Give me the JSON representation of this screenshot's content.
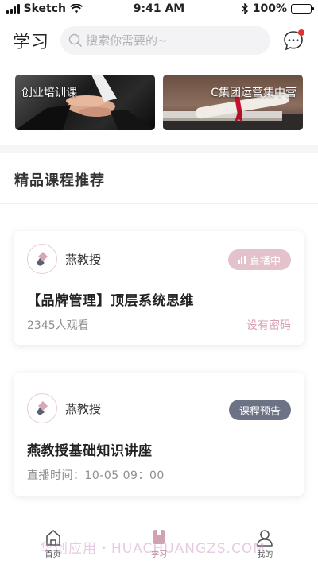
{
  "status_bar": {
    "carrier": "Sketch",
    "time": "9:41 AM",
    "battery": "100%"
  },
  "header": {
    "title": "学习",
    "search_placeholder": "搜索你需要的~"
  },
  "banners": [
    {
      "label": "创业培训课"
    },
    {
      "label": "C集团运营集中营"
    }
  ],
  "section": {
    "title": "精品课程推荐"
  },
  "courses": [
    {
      "teacher": "燕教授",
      "badge": "直播中",
      "title": "【品牌管理】顶层系统思维",
      "meta": "2345人观看",
      "note": "设有密码"
    },
    {
      "teacher": "燕教授",
      "badge": "课程预告",
      "title": "燕教授基础知识讲座",
      "meta": "直播时间：10-05   09：00"
    }
  ],
  "tabbar": {
    "items": [
      {
        "label": "首页"
      },
      {
        "label": "学习"
      },
      {
        "label": "我的"
      }
    ]
  },
  "watermark": "华创应用・HUACHUANGZS.COM",
  "colors": {
    "accent": "#b88a98",
    "badge_live": "#e4c2cb",
    "badge_preview": "#6c7385",
    "dot": "#e8312f"
  }
}
